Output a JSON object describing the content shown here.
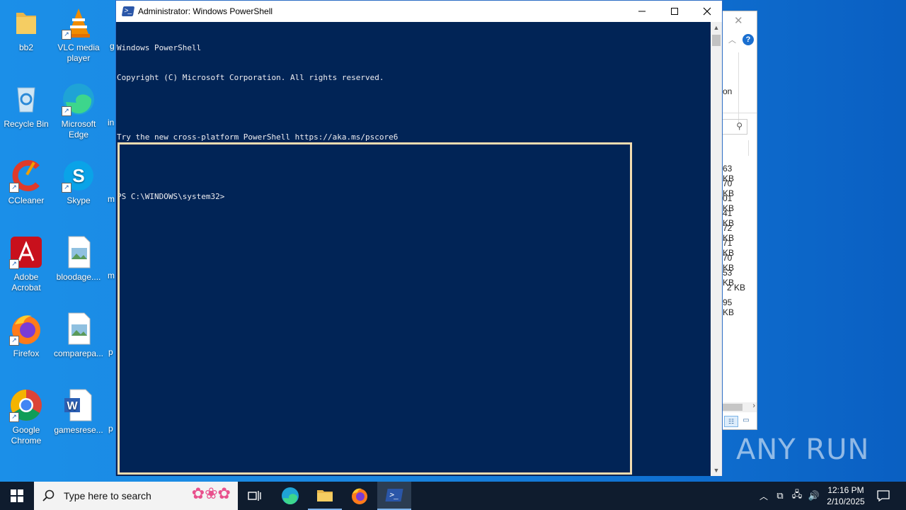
{
  "desktop": {
    "icons": [
      {
        "label": "bb2"
      },
      {
        "label": "VLC media\nplayer"
      },
      {
        "label": "Recycle Bin"
      },
      {
        "label": "Microsoft\nEdge"
      },
      {
        "label": "CCleaner"
      },
      {
        "label": "Skype"
      },
      {
        "label": "Adobe\nAcrobat"
      },
      {
        "label": "bloodage...."
      },
      {
        "label": "Firefox"
      },
      {
        "label": "comparepa..."
      },
      {
        "label": "Google\nChrome"
      },
      {
        "label": "gamesrese..."
      }
    ],
    "clipped_labels": [
      "g",
      "in",
      "m",
      "m",
      "p",
      "p"
    ]
  },
  "explorer": {
    "partial_text": "on",
    "sizes": [
      "63 KB",
      "70 KB",
      "01 KB",
      "41 KB",
      "72 KB",
      "71 KB",
      "70 KB",
      "53 KB",
      "2 KB",
      "95 KB"
    ]
  },
  "powershell": {
    "title": "Administrator: Windows PowerShell",
    "lines": [
      "Windows PowerShell",
      "Copyright (C) Microsoft Corporation. All rights reserved.",
      "",
      "Try the new cross-platform PowerShell https://aka.ms/pscore6",
      "",
      "PS C:\\WINDOWS\\system32>"
    ],
    "colors": {
      "background": "#012456",
      "text": "#eeedf0"
    }
  },
  "taskbar": {
    "search_placeholder": "Type here to search",
    "time": "12:16 PM",
    "date": "2/10/2025"
  },
  "watermark": "ANY RUN"
}
